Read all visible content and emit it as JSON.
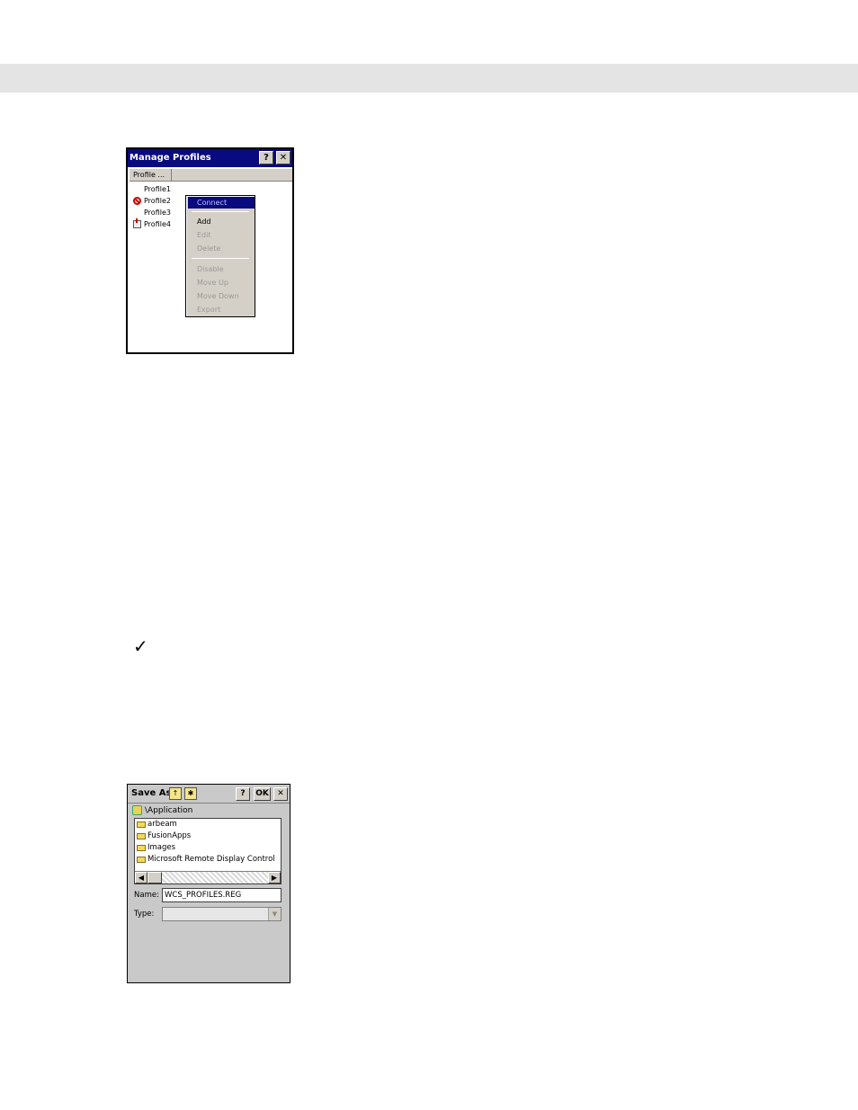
{
  "manage_profiles": {
    "title": "Manage Profiles",
    "help_button": "?",
    "close_button": "✕",
    "column_header": "Profile ...",
    "profiles": [
      {
        "label": "Profile1",
        "icon": "none"
      },
      {
        "label": "Profile2",
        "icon": "disabled-icon"
      },
      {
        "label": "Profile3",
        "icon": "none"
      },
      {
        "label": "Profile4",
        "icon": "export-icon"
      }
    ],
    "context_menu": {
      "connect": "Connect",
      "add": "Add",
      "edit": "Edit",
      "delete": "Delete",
      "disable": "Disable",
      "move_up": "Move Up",
      "move_down": "Move Down",
      "export": "Export"
    }
  },
  "note_icon": "✓",
  "save_as": {
    "title": "Save As",
    "help_button": "?",
    "ok_button": "OK",
    "close_button": "✕",
    "path": "\\Application",
    "folders": [
      "arbeam",
      "FusionApps",
      "Images",
      "Microsoft Remote Display Control"
    ],
    "scroll_left": "◀",
    "scroll_right": "▶",
    "name_label": "Name:",
    "name_value": "WCS_PROFILES.REG",
    "type_label": "Type:",
    "type_value": ""
  },
  "colors": {
    "titlebar": "#0a0a80",
    "dialog_bg": "#c9c9c9",
    "header_band": "#e4e4e4"
  }
}
